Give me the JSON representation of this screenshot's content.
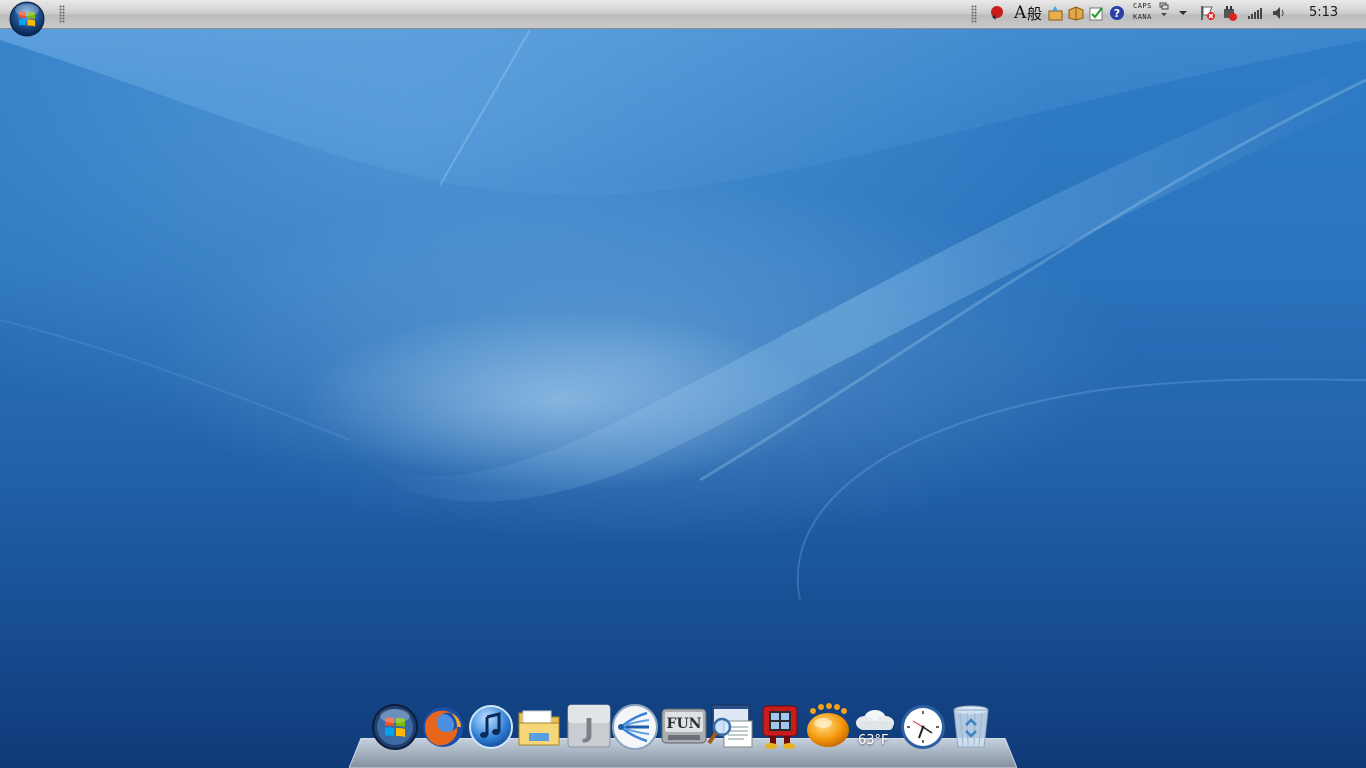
{
  "colors": {
    "desktop_top": "#2f7cc7",
    "desktop_bottom": "#0f3a78",
    "topbar": "#cfcfcf",
    "dock_shelf": "#bfc6cc"
  },
  "top_bar": {
    "start_button": {
      "icon": "windows-logo-icon"
    },
    "ime": {
      "mode_a": "A",
      "mode_kanji": "般"
    },
    "caps_label": "CAPS",
    "kana_label": "KANA",
    "clock": "5:13",
    "tray_icons": [
      "security-shield-icon",
      "ime-pad-icon",
      "ime-dictionary-icon",
      "ime-tools-icon",
      "help-icon",
      "ime-options-icon",
      "tray-expand-icon",
      "action-center-flag-icon",
      "network-plug-icon",
      "signal-bars-icon",
      "volume-icon"
    ]
  },
  "dock": {
    "items": [
      {
        "name": "windows-start",
        "icon": "windows-logo-icon"
      },
      {
        "name": "firefox",
        "icon": "firefox-icon"
      },
      {
        "name": "itunes",
        "icon": "itunes-note-icon"
      },
      {
        "name": "explorer",
        "icon": "folder-icon"
      },
      {
        "name": "j-app",
        "icon": "letter-j-icon"
      },
      {
        "name": "share-app",
        "icon": "share-arrow-icon"
      },
      {
        "name": "fun-app",
        "icon": "fun-disk-icon"
      },
      {
        "name": "document-viewer",
        "icon": "magnifier-document-icon"
      },
      {
        "name": "red-robot-app",
        "icon": "robot-icon"
      },
      {
        "name": "gom-player",
        "icon": "orange-crown-icon"
      },
      {
        "name": "weather",
        "icon": "cloud-icon",
        "temperature": "63°F"
      },
      {
        "name": "clock",
        "icon": "analog-clock-icon"
      },
      {
        "name": "recycle-bin",
        "icon": "recycle-bin-icon"
      }
    ]
  }
}
